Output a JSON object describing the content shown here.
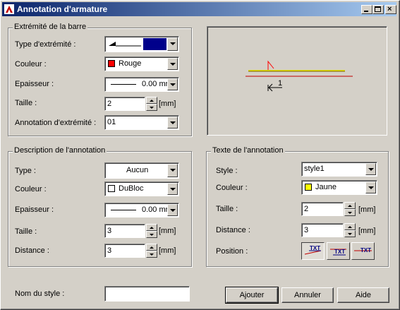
{
  "window": {
    "title": "Annotation d'armature"
  },
  "extremite": {
    "title": "Extrémité de la barre",
    "type_label": "Type d'extrémité :",
    "couleur_label": "Couleur :",
    "couleur_value": "Rouge",
    "couleur_color": "#ff0000",
    "type_color": "#00008b",
    "epaisseur_label": "Epaisseur :",
    "epaisseur_value": "0.00 mr",
    "taille_label": "Taille :",
    "taille_value": "2",
    "taille_unit": "[mm]",
    "annotation_label": "Annotation d'extrémité :",
    "annotation_value": "01"
  },
  "description": {
    "title": "Description de l'annotation",
    "type_label": "Type :",
    "type_value": "Aucun",
    "couleur_label": "Couleur :",
    "couleur_value": "DuBloc",
    "couleur_color": "#ffffff",
    "epaisseur_label": "Epaisseur :",
    "epaisseur_value": "0.00 mr",
    "taille_label": "Taille :",
    "taille_value": "3",
    "taille_unit": "[mm]",
    "distance_label": "Distance :",
    "distance_value": "3",
    "distance_unit": "[mm]"
  },
  "texte": {
    "title": "Texte de l'annotation",
    "style_label": "Style :",
    "style_value": "style1",
    "couleur_label": "Couleur :",
    "couleur_value": "Jaune",
    "couleur_color": "#ffff00",
    "taille_label": "Taille :",
    "taille_value": "2",
    "taille_unit": "[mm]",
    "distance_label": "Distance :",
    "distance_value": "3",
    "distance_unit": "[mm]",
    "position_label": "Position :",
    "position_buttons": [
      "TXT",
      "TXT",
      "TXT"
    ]
  },
  "preview": {
    "annotation_text": "1"
  },
  "footer": {
    "nom_label": "Nom du style :",
    "nom_value": "",
    "ajouter": "Ajouter",
    "annuler": "Annuler",
    "aide": "Aide"
  }
}
